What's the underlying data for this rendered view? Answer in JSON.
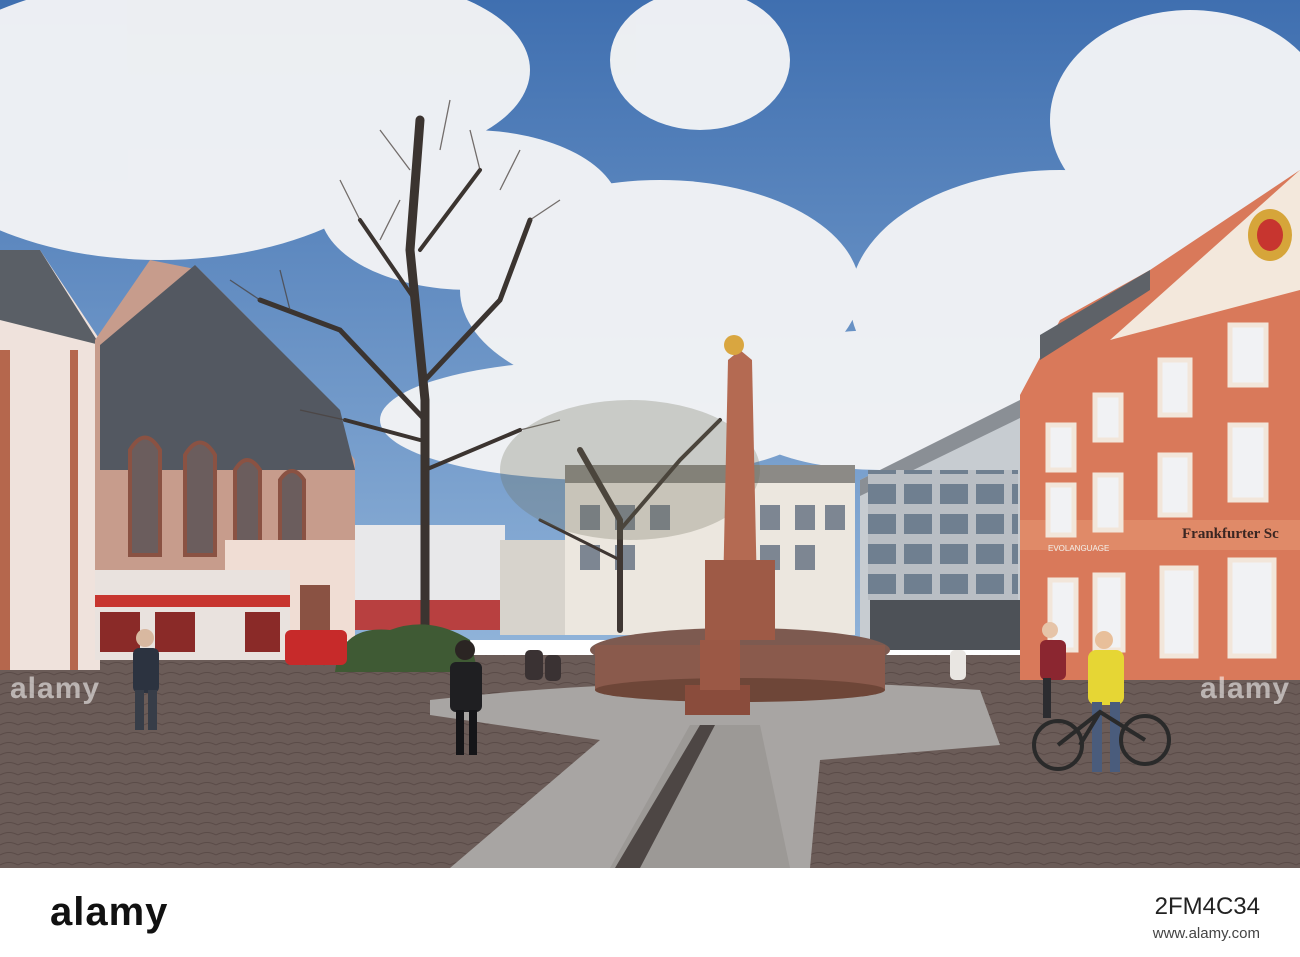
{
  "photo": {
    "signs": {
      "bank": "Frankfurter Sc",
      "store": "EVOLANGUAGE"
    }
  },
  "watermark": {
    "logo": "alamy",
    "image_id": "2FM4C34",
    "url": "www.alamy.com"
  }
}
